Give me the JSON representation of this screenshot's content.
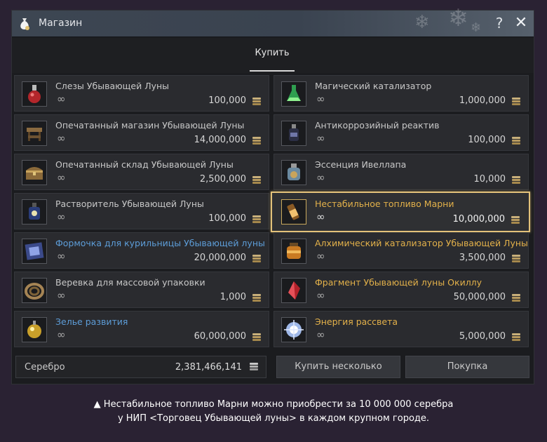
{
  "window": {
    "title": "Магазин",
    "title_icon": "money-bag-icon",
    "help_label": "?",
    "close_icon": "close-icon"
  },
  "tabs": [
    {
      "label": "Купить",
      "active": true
    }
  ],
  "items": [
    {
      "name": "Слезы Убывающей Луны",
      "stock": "∞",
      "price": "100,000",
      "name_color": "#c8c8c8",
      "icon": "red-potion-icon"
    },
    {
      "name": "Магический катализатор",
      "stock": "∞",
      "price": "1,000,000",
      "name_color": "#c8c8c8",
      "icon": "green-flask-icon"
    },
    {
      "name": "Опечатанный магазин Убывающей Луны",
      "stock": "∞",
      "price": "14,000,000",
      "name_color": "#c8c8c8",
      "icon": "stall-icon"
    },
    {
      "name": "Антикоррозийный реактив",
      "stock": "∞",
      "price": "100,000",
      "name_color": "#c8c8c8",
      "icon": "dark-bottle-icon"
    },
    {
      "name": "Опечатанный склад Убывающей Луны",
      "stock": "∞",
      "price": "2,500,000",
      "name_color": "#c8c8c8",
      "icon": "chest-icon"
    },
    {
      "name": "Эссенция Ивеллапа",
      "stock": "∞",
      "price": "10,000",
      "name_color": "#c8c8c8",
      "icon": "essence-jar-icon"
    },
    {
      "name": "Растворитель Убывающей Луны",
      "stock": "∞",
      "price": "100,000",
      "name_color": "#c8c8c8",
      "icon": "blue-bottle-icon"
    },
    {
      "name": "Нестабильное топливо Марни",
      "stock": "∞",
      "price": "10,000,000",
      "name_color": "#e3b14a",
      "icon": "fuel-vial-icon",
      "selected": true
    },
    {
      "name": "Формочка для курильницы Убывающей луны",
      "stock": "∞",
      "price": "20,000,000",
      "name_color": "#5d9dd8",
      "icon": "mold-icon"
    },
    {
      "name": "Алхимический катализатор Убывающей Луны",
      "stock": "∞",
      "price": "3,500,000",
      "name_color": "#e3b14a",
      "icon": "amber-jar-icon"
    },
    {
      "name": "Веревка для массовой упаковки",
      "stock": "∞",
      "price": "1,000",
      "name_color": "#c8c8c8",
      "icon": "rope-icon"
    },
    {
      "name": "Фрагмент Убывающей луны Окиллу",
      "stock": "∞",
      "price": "50,000,000",
      "name_color": "#e3b14a",
      "icon": "crystal-fragment-icon"
    },
    {
      "name": "Зелье развития",
      "stock": "∞",
      "price": "60,000,000",
      "name_color": "#5d9dd8",
      "icon": "growth-potion-icon"
    },
    {
      "name": "Энергия рассвета",
      "stock": "∞",
      "price": "5,000,000",
      "name_color": "#e3b14a",
      "icon": "dawn-energy-icon"
    }
  ],
  "footer": {
    "silver_label": "Серебро",
    "silver_amount": "2,381,466,141",
    "buy_multiple_label": "Купить несколько",
    "buy_label": "Покупка"
  },
  "caption": {
    "line1": "▲ Нестабильное топливо Марни можно приобрести за 10 000 000 серебра",
    "line2": "у НИП <Торговец Убывающей луны> в каждом крупном городе."
  },
  "colors": {
    "accent_gold": "#e3b14a",
    "selected_border": "#e3c27a",
    "link_blue": "#5d9dd8",
    "background": "#2a2233"
  }
}
